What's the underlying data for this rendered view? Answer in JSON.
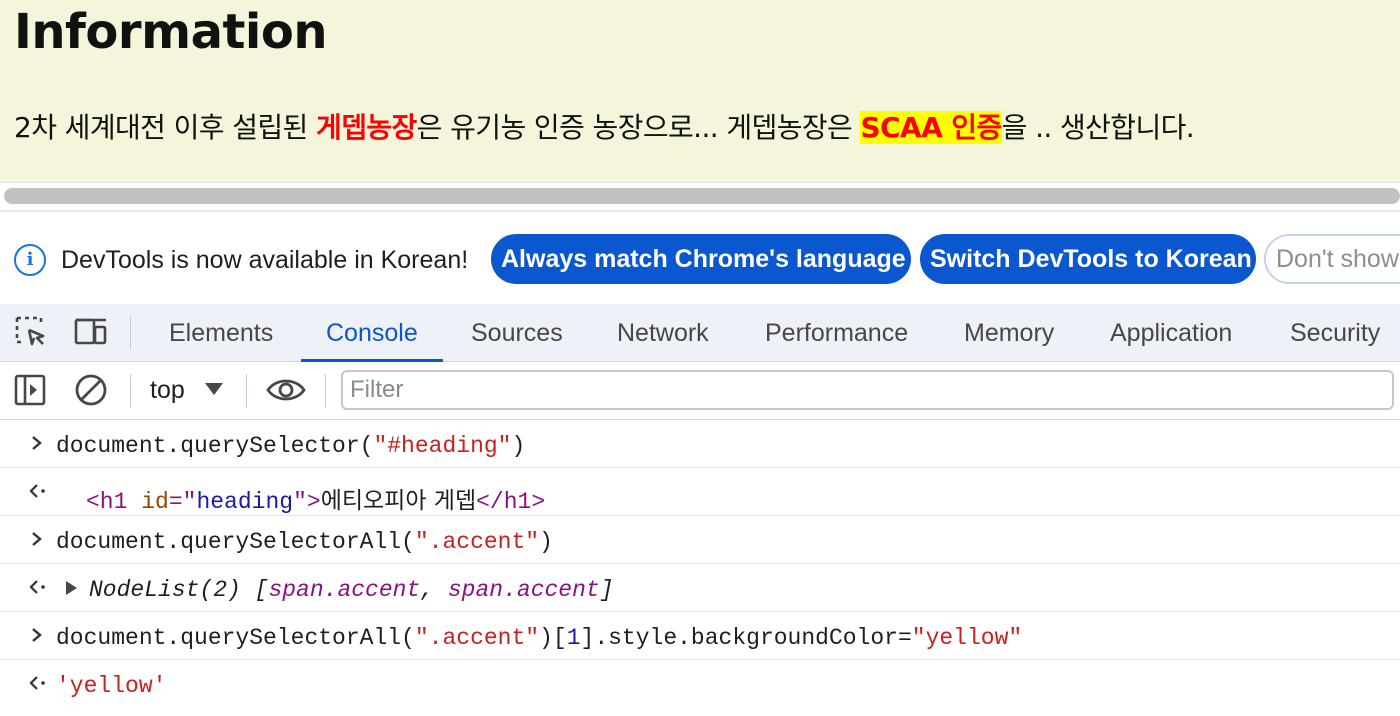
{
  "page": {
    "heading": "Information",
    "paragraph": {
      "part1": "2차 세계대전 이후 설립된 ",
      "accent1": "게뎁농장",
      "part2": "은 유기농 인증 농장으로... 게뎁농장은 ",
      "accent2": "SCAA 인증",
      "part3": "을 .. 생산합니다."
    }
  },
  "infobar": {
    "icon": "info-icon",
    "message": "DevTools is now available in Korean!",
    "buttons": {
      "match": "Always match Chrome's language",
      "switch": "Switch DevTools to Korean",
      "dont_show": "Don't show"
    }
  },
  "tabs": [
    {
      "label": "Elements"
    },
    {
      "label": "Console"
    },
    {
      "label": "Sources"
    },
    {
      "label": "Network"
    },
    {
      "label": "Performance"
    },
    {
      "label": "Memory"
    },
    {
      "label": "Application"
    },
    {
      "label": "Security"
    }
  ],
  "active_tab": "Console",
  "consolebar": {
    "context": "top",
    "filter_placeholder": "Filter"
  },
  "console": {
    "lines": [
      {
        "kind": "input",
        "t1": "document.querySelector(",
        "t2": "\"#heading\"",
        "t3": ")"
      },
      {
        "kind": "output",
        "t1": "<h1",
        "t2": "id",
        "t3": "=\"",
        "t4": "heading",
        "t5": "\">",
        "t6": "에티오피아 게뎁",
        "t7": "</h1>"
      },
      {
        "kind": "input",
        "t1": "document.querySelectorAll(",
        "t2": "\".accent\"",
        "t3": ")"
      },
      {
        "kind": "output",
        "t1": "NodeList(2) [",
        "t2": "span.accent",
        "t3": ", ",
        "t4": "span.accent",
        "t5": "]"
      },
      {
        "kind": "input",
        "t1": "document.querySelectorAll(",
        "t2": "\".accent\"",
        "t3": ")[",
        "t4": "1",
        "t5": "].style.backgroundColor=",
        "t6": "\"yellow\""
      },
      {
        "kind": "output",
        "t1": "'yellow'"
      }
    ]
  },
  "colors": {
    "page_bg": "#f5f5dc",
    "accent": "#ff0000",
    "highlight": "#ffff00",
    "devtools_blue": "#0b57d0"
  }
}
